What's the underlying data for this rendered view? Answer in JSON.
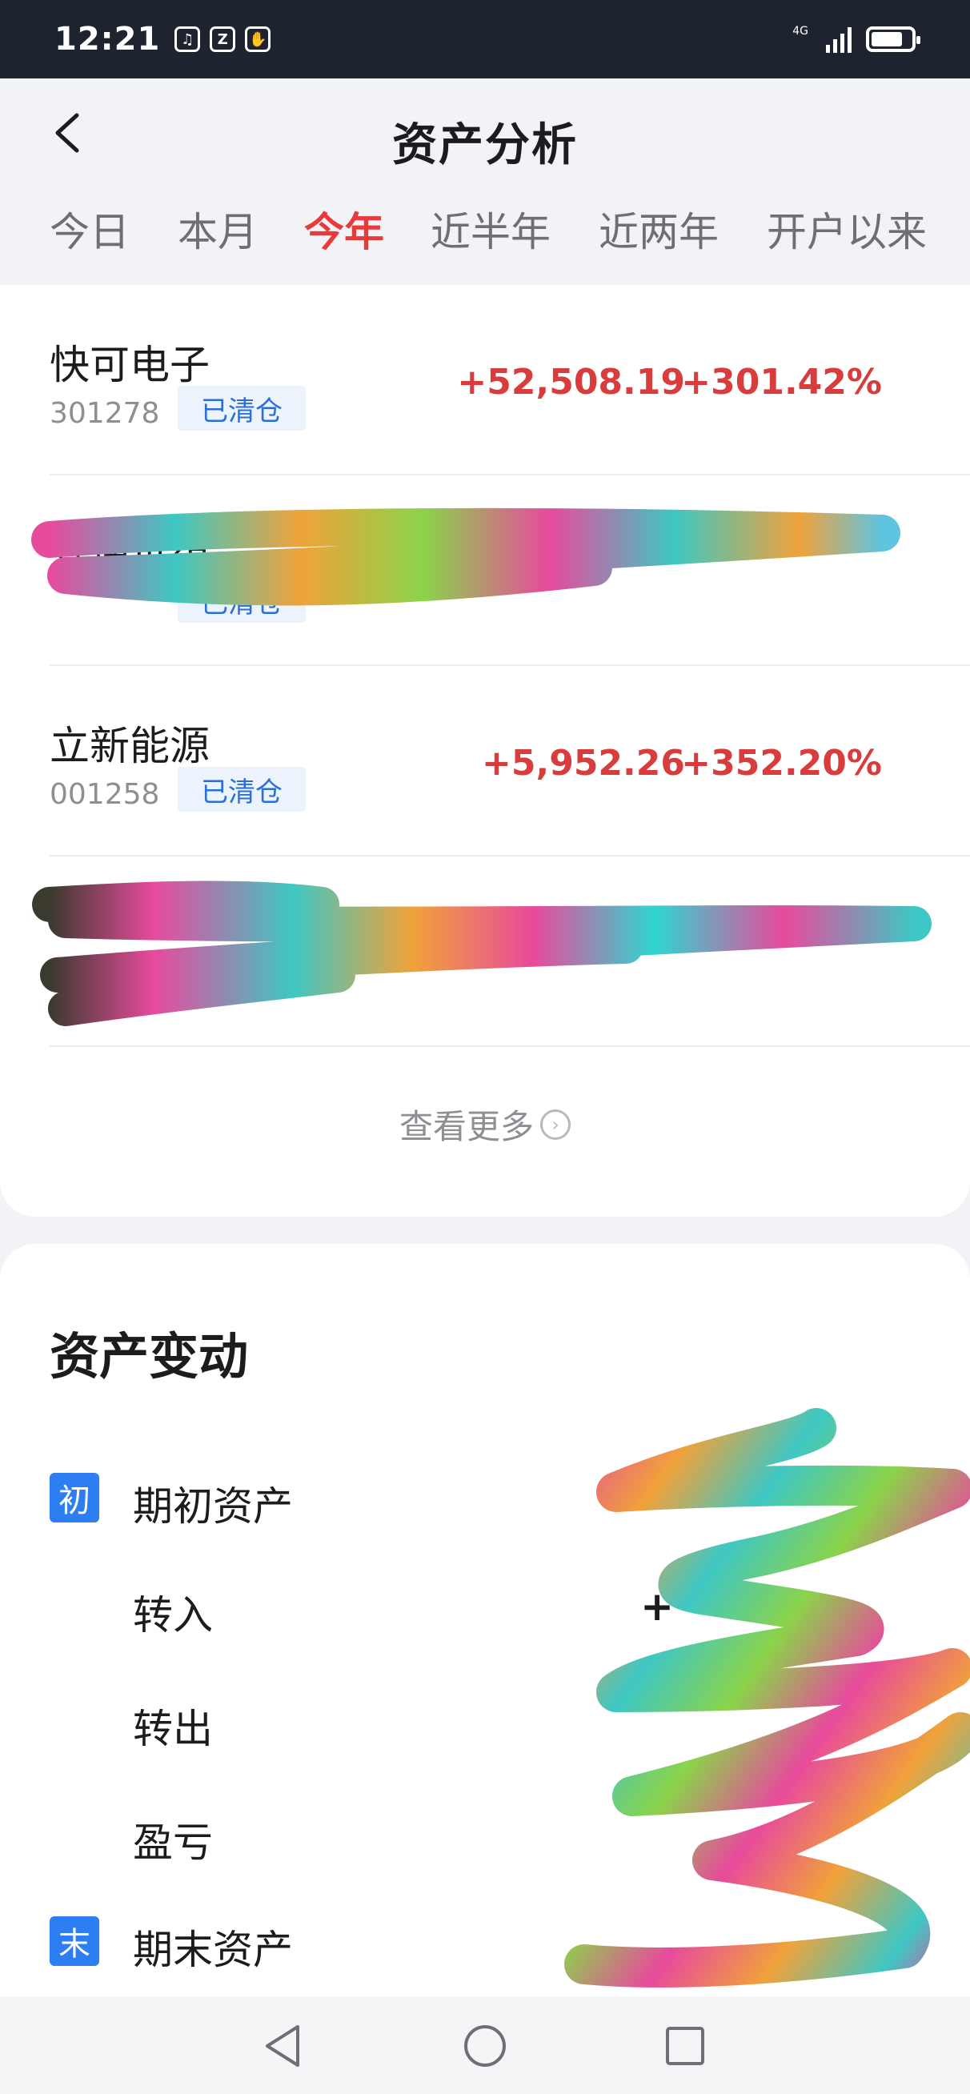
{
  "status_bar": {
    "time": "12:21",
    "network": "4G",
    "app_icons": [
      "music-app-icon",
      "alipay-icon",
      "shield-hand-icon"
    ],
    "battery_level": 0.8
  },
  "header": {
    "title": "资产分析",
    "back_icon": "chevron-left-icon"
  },
  "tabs": [
    {
      "label": "今日",
      "active": false
    },
    {
      "label": "本月",
      "active": false
    },
    {
      "label": "今年",
      "active": true
    },
    {
      "label": "近半年",
      "active": false
    },
    {
      "label": "近两年",
      "active": false
    },
    {
      "label": "开户以来",
      "active": false
    }
  ],
  "stocks": [
    {
      "name": "快可电子",
      "code": "301278",
      "tag": "已清仓",
      "profit": "+52,508.19",
      "pct": "+301.42%",
      "redacted": false
    },
    {
      "name": "宜通世纪",
      "code": "",
      "tag": "已清仓",
      "profit": "",
      "pct": "",
      "redacted": true
    },
    {
      "name": "立新能源",
      "code": "001258",
      "tag": "已清仓",
      "profit": "+5,952.26",
      "pct": "+352.20%",
      "redacted": false
    },
    {
      "name": "",
      "code": "",
      "tag": "",
      "profit": "",
      "pct": "",
      "redacted": true
    }
  ],
  "more_link": {
    "label": "查看更多",
    "icon": "circle-chevron-right-icon"
  },
  "asset_change": {
    "title": "资产变动",
    "rows": [
      {
        "badge": "初",
        "label": "期初资产",
        "value": ""
      },
      {
        "badge": "",
        "label": "转入",
        "value": "+"
      },
      {
        "badge": "",
        "label": "转出",
        "value": ""
      },
      {
        "badge": "",
        "label": "盈亏",
        "value": ""
      },
      {
        "badge": "末",
        "label": "期末资产",
        "value": ""
      }
    ]
  },
  "nav_bar": {
    "back_icon": "triangle-back-icon",
    "home_icon": "circle-home-icon",
    "recents_icon": "square-recents-icon"
  },
  "colors": {
    "accent_red": "#e83a3a",
    "profit_red": "#d93c3c",
    "badge_blue": "#2d7ef0",
    "tag_blue": "#2a6fd6",
    "status_bar_bg": "#1e2330"
  }
}
